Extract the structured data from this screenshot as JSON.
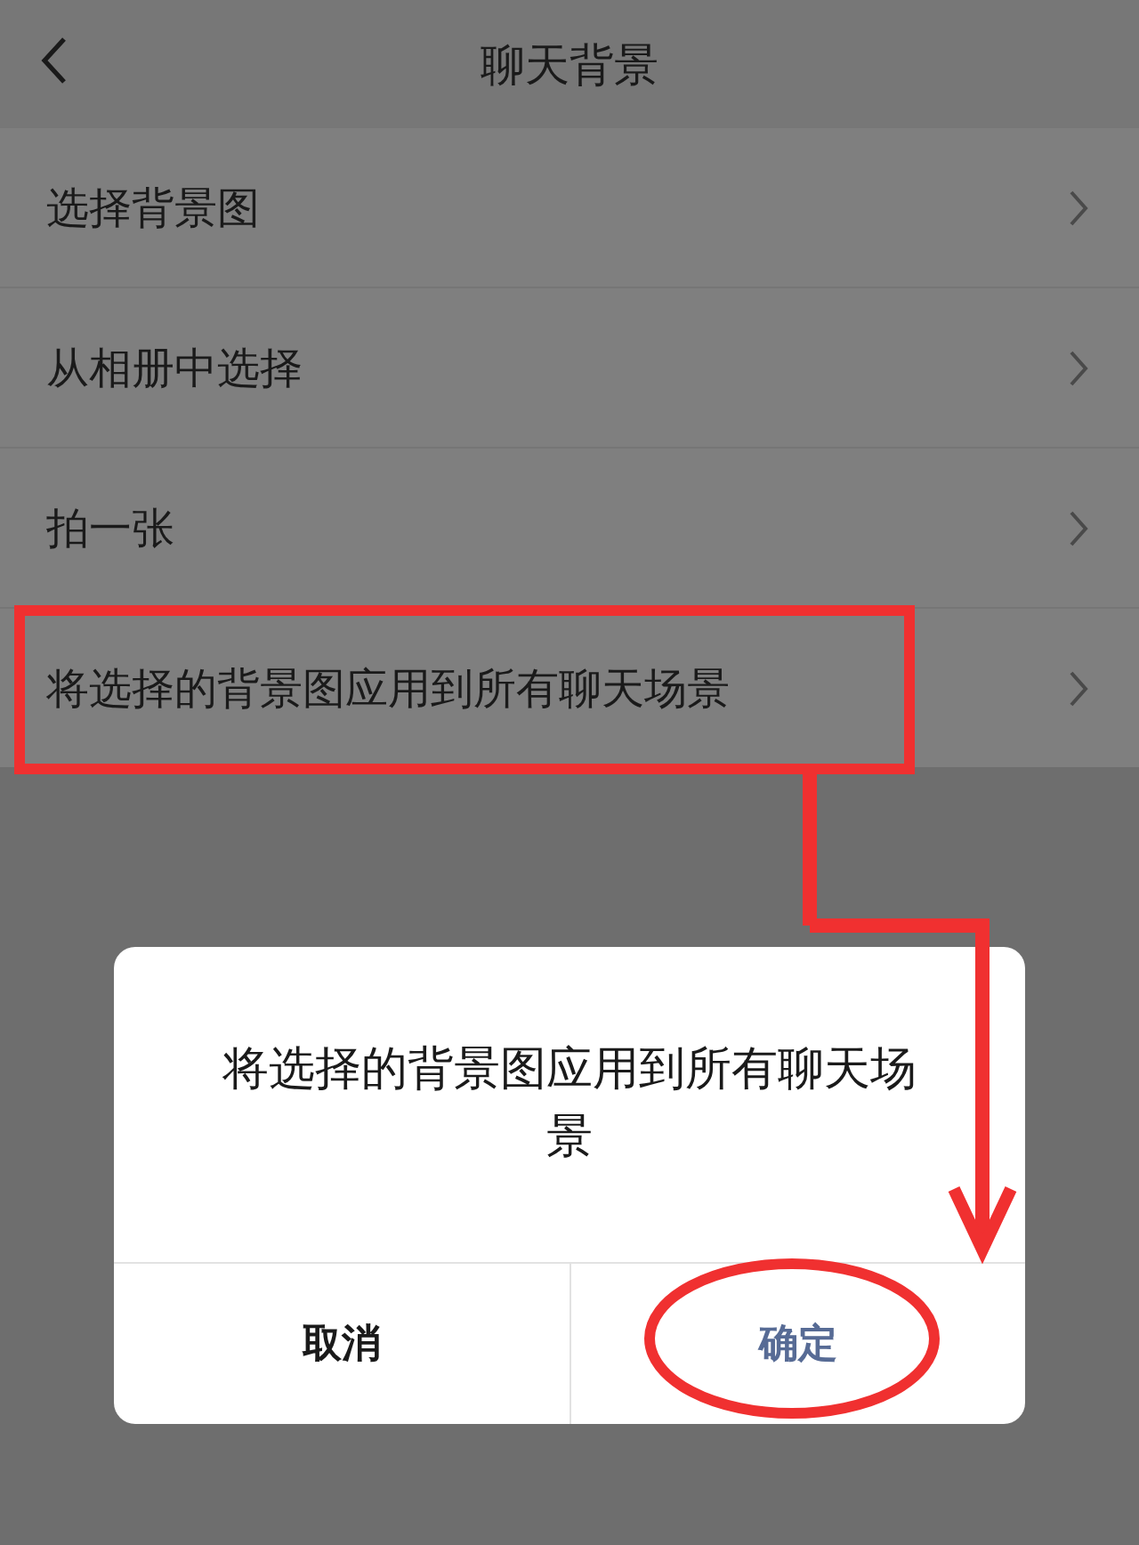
{
  "header": {
    "title": "聊天背景"
  },
  "items": [
    {
      "label": "选择背景图"
    },
    {
      "label": "从相册中选择"
    },
    {
      "label": "拍一张"
    },
    {
      "label": "将选择的背景图应用到所有聊天场景"
    }
  ],
  "dialog": {
    "message": "将选择的背景图应用到所有聊天场景",
    "buttons": [
      {
        "label": "取消",
        "kind": "cancel"
      },
      {
        "label": "确定",
        "kind": "confirm"
      }
    ]
  }
}
